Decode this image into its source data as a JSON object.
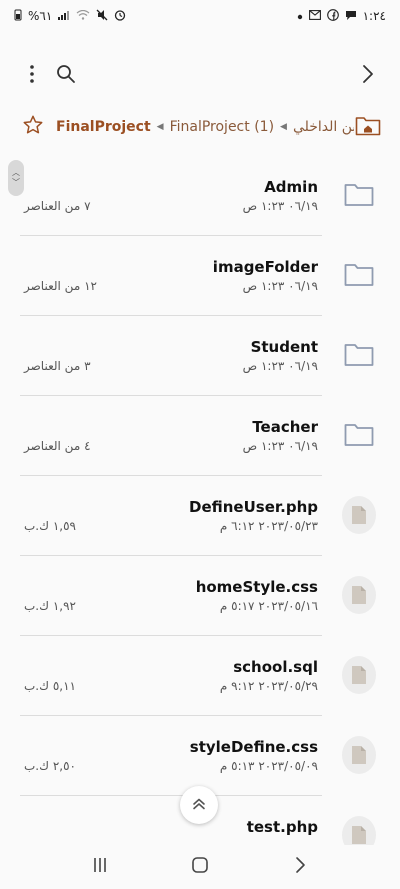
{
  "status_bar": {
    "battery": "%٦١",
    "time": "١:٢٤"
  },
  "toolbar": {
    "menu_icon": "more-vertical-icon",
    "search_icon": "search-icon",
    "back_icon": "chevron-right-icon"
  },
  "breadcrumb": {
    "items": [
      "FinalProject",
      "FinalProject (1)",
      "بن الداخلي"
    ]
  },
  "files": [
    {
      "name": "Admin",
      "date": "٠٦/١٩ ١:٢٣ ص",
      "info": "٧ من العناصر",
      "type": "folder"
    },
    {
      "name": "imageFolder",
      "date": "٠٦/١٩ ١:٢٣ ص",
      "info": "١٢ من العناصر",
      "type": "folder"
    },
    {
      "name": "Student",
      "date": "٠٦/١٩ ١:٢٣ ص",
      "info": "٣ من العناصر",
      "type": "folder"
    },
    {
      "name": "Teacher",
      "date": "٠٦/١٩ ١:٢٣ ص",
      "info": "٤ من العناصر",
      "type": "folder"
    },
    {
      "name": "DefineUser.php",
      "date": "٢٠٢٣/٠٥/٢٣ ٦:١٢ م",
      "info": "١,٥٩ ك.ب",
      "type": "file"
    },
    {
      "name": "homeStyle.css",
      "date": "٢٠٢٣/٠٥/١٦ ٥:١٧ م",
      "info": "١,٩٢ ك.ب",
      "type": "file"
    },
    {
      "name": "school.sql",
      "date": "٢٠٢٣/٠٥/٢٩ ٩:١٢ م",
      "info": "٥,١١ ك.ب",
      "type": "file"
    },
    {
      "name": "styleDefine.css",
      "date": "٢٠٢٣/٠٥/٠٩ ٥:١٣ م",
      "info": "٢,٥٠ ك.ب",
      "type": "file"
    },
    {
      "name": "test.php",
      "date": "",
      "info": "",
      "type": "file"
    }
  ],
  "colors": {
    "accent": "#9b4f22",
    "folder_icon": "#8f9bb0"
  }
}
